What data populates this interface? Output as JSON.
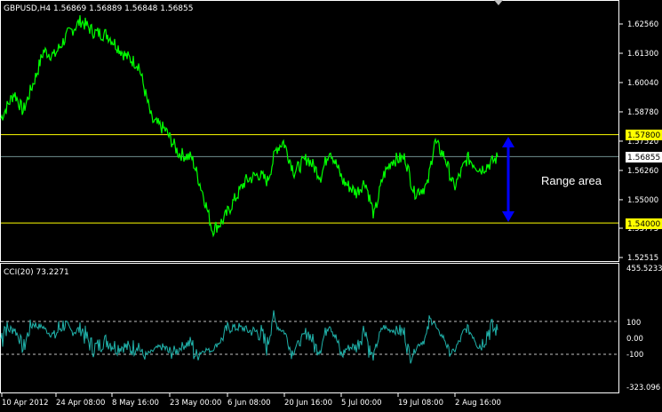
{
  "header": {
    "symbol_info": "GBPUSD,H4  1.56869 1.56889 1.56848 1.56855"
  },
  "main_chart": {
    "price_scale": [
      {
        "label": "1.62560",
        "value": 1.6256
      },
      {
        "label": "1.61300",
        "value": 1.613
      },
      {
        "label": "1.60040",
        "value": 1.6004
      },
      {
        "label": "1.58780",
        "value": 1.5878
      },
      {
        "label": "1.57520",
        "value": 1.5752
      },
      {
        "label": "1.56260",
        "value": 1.5626
      },
      {
        "label": "1.55000",
        "value": 1.55
      },
      {
        "label": "1.53775",
        "value": 1.53775
      },
      {
        "label": "1.52515",
        "value": 1.52515
      }
    ],
    "levels": [
      {
        "label": "1.57800",
        "value": 1.578,
        "color": "#ffff00",
        "kind": "horizontal-line"
      },
      {
        "label": "1.54000",
        "value": 1.54,
        "color": "#ffff00",
        "kind": "horizontal-line"
      }
    ],
    "bid": {
      "label": "1.56855",
      "value": 1.56855,
      "line_color": "#6f8f8f"
    },
    "annotation": "Range area",
    "arrow_color": "#0000ff",
    "price_color": "#00ff00"
  },
  "indicator": {
    "title": "CCI(20) 73.2271",
    "scale": [
      {
        "label": "455.5233",
        "value": 455.5233
      },
      {
        "label": "100",
        "value": 100
      },
      {
        "label": "0.00",
        "value": 0
      },
      {
        "label": "-100",
        "value": -100
      },
      {
        "label": "-323.096",
        "value": -323.096
      }
    ],
    "line_color": "#20b2aa"
  },
  "time_axis": [
    "10 Apr 2012",
    "24 Apr 08:00",
    "8 May 16:00",
    "23 May 00:00",
    "6 Jun 08:00",
    "20 Jun 16:00",
    "5 Jul 00:00",
    "19 Jul 08:00",
    "2 Aug 16:00"
  ],
  "chart_data": {
    "type": "line",
    "title": "GBPUSD,H4",
    "x": [
      "10 Apr 2012",
      "24 Apr 08:00",
      "8 May 16:00",
      "23 May 00:00",
      "6 Jun 08:00",
      "20 Jun 16:00",
      "5 Jul 00:00",
      "19 Jul 08:00",
      "2 Aug 16:00"
    ],
    "price_anchors": [
      [
        0,
        1.585
      ],
      [
        15,
        1.596
      ],
      [
        25,
        1.588
      ],
      [
        40,
        1.604
      ],
      [
        48,
        1.614
      ],
      [
        60,
        1.612
      ],
      [
        75,
        1.621
      ],
      [
        90,
        1.627
      ],
      [
        105,
        1.622
      ],
      [
        120,
        1.621
      ],
      [
        140,
        1.612
      ],
      [
        155,
        1.608
      ],
      [
        170,
        1.584
      ],
      [
        185,
        1.58
      ],
      [
        200,
        1.57
      ],
      [
        215,
        1.568
      ],
      [
        228,
        1.552
      ],
      [
        238,
        1.537
      ],
      [
        250,
        1.541
      ],
      [
        260,
        1.548
      ],
      [
        275,
        1.558
      ],
      [
        290,
        1.561
      ],
      [
        300,
        1.558
      ],
      [
        310,
        1.572
      ],
      [
        318,
        1.575
      ],
      [
        330,
        1.562
      ],
      [
        345,
        1.568
      ],
      [
        360,
        1.56
      ],
      [
        370,
        1.572
      ],
      [
        385,
        1.558
      ],
      [
        400,
        1.553
      ],
      [
        410,
        1.558
      ],
      [
        420,
        1.543
      ],
      [
        430,
        1.56
      ],
      [
        440,
        1.567
      ],
      [
        455,
        1.568
      ],
      [
        465,
        1.553
      ],
      [
        480,
        1.556
      ],
      [
        488,
        1.575
      ],
      [
        500,
        1.568
      ],
      [
        510,
        1.555
      ],
      [
        525,
        1.568
      ],
      [
        540,
        1.563
      ],
      [
        552,
        1.566
      ],
      [
        560,
        1.5685
      ]
    ],
    "cci_ylim": [
      -323.096,
      455.5233
    ],
    "price_ylim": [
      1.52515,
      1.6256
    ]
  }
}
